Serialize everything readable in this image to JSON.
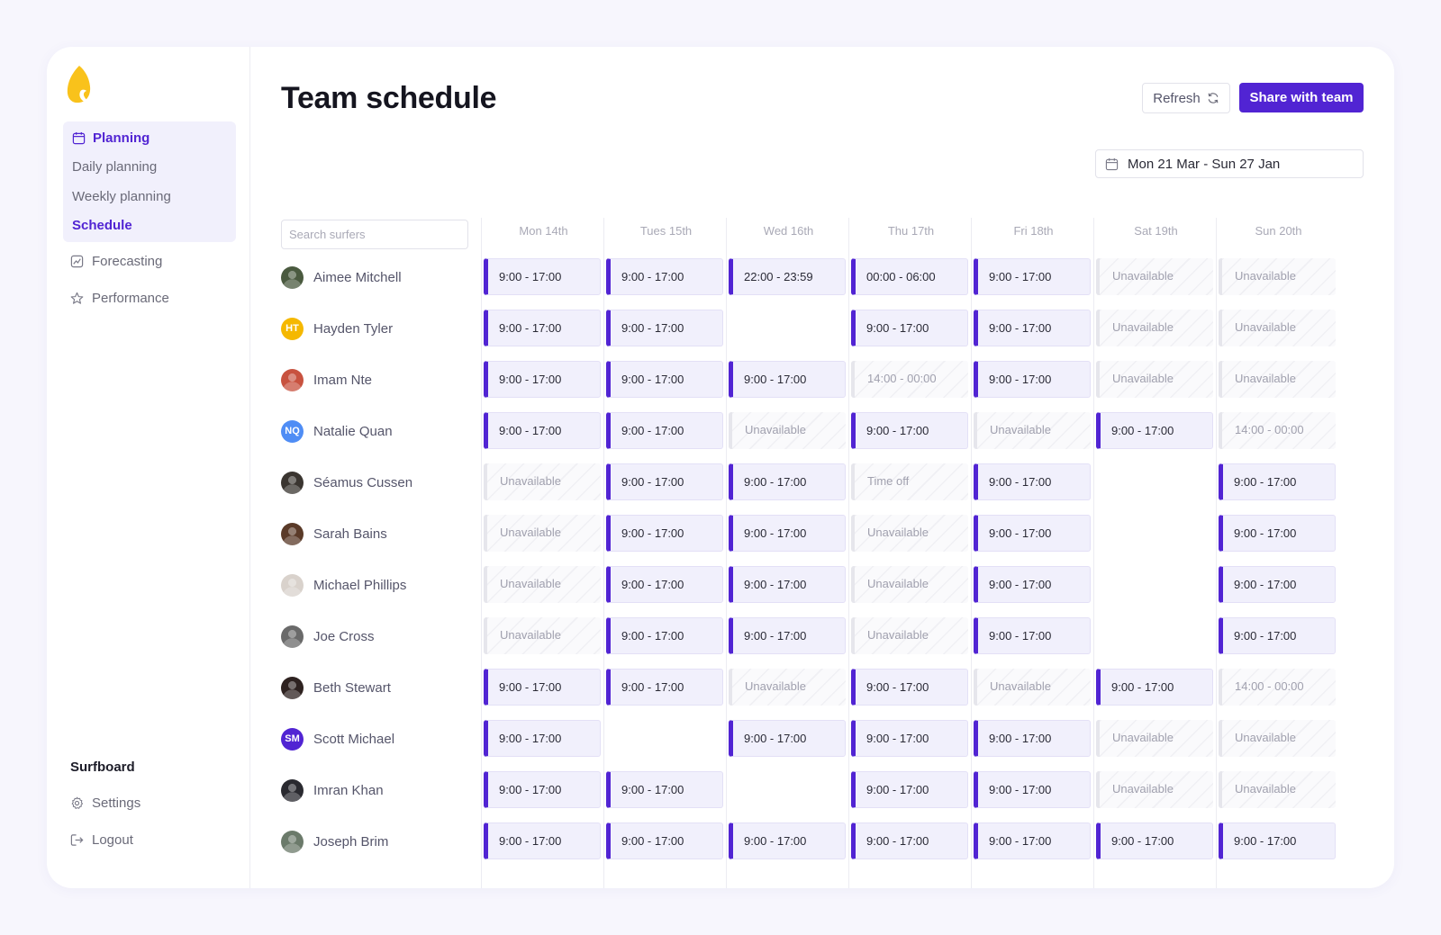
{
  "app": {
    "brand_name": "Surfboard",
    "accent_color": "#5124d3",
    "logo_color": "#f9c21b"
  },
  "sidebar": {
    "planning_label": "Planning",
    "planning_icon": "calendar-icon",
    "sub_items": [
      {
        "label": "Daily planning",
        "active": false
      },
      {
        "label": "Weekly planning",
        "active": false
      },
      {
        "label": "Schedule",
        "active": true
      }
    ],
    "items": [
      {
        "label": "Forecasting",
        "icon": "chart-icon"
      },
      {
        "label": "Performance",
        "icon": "star-icon"
      }
    ],
    "bottom_items": [
      {
        "label": "Settings",
        "icon": "gear-icon"
      },
      {
        "label": "Logout",
        "icon": "logout-icon"
      }
    ]
  },
  "header": {
    "title": "Team schedule",
    "refresh_label": "Refresh",
    "share_label": "Share with team",
    "date_range": "Mon 21 Mar - Sun 27 Jan"
  },
  "search": {
    "placeholder": "Search surfers"
  },
  "days": [
    "Mon 14th",
    "Tues 15th",
    "Wed 16th",
    "Thu 17th",
    "Fri 18th",
    "Sat 19th",
    "Sun 20th"
  ],
  "people": [
    {
      "name": "Aimee Mitchell",
      "avatar_initials": "",
      "avatar_color": "#4a5a3f",
      "shifts": [
        {
          "text": "9:00 - 17:00",
          "status": "on"
        },
        {
          "text": "9:00 - 17:00",
          "status": "on"
        },
        {
          "text": "22:00 - 23:59",
          "status": "on"
        },
        {
          "text": "00:00 - 06:00",
          "status": "on"
        },
        {
          "text": "9:00 - 17:00",
          "status": "on"
        },
        {
          "text": "Unavailable",
          "status": "off"
        },
        {
          "text": "Unavailable",
          "status": "off"
        }
      ]
    },
    {
      "name": "Hayden Tyler",
      "avatar_initials": "HT",
      "avatar_color": "#f5b800",
      "shifts": [
        {
          "text": "9:00 - 17:00",
          "status": "on"
        },
        {
          "text": "9:00 - 17:00",
          "status": "on"
        },
        {
          "text": "",
          "status": "empty"
        },
        {
          "text": "9:00 - 17:00",
          "status": "on"
        },
        {
          "text": "9:00 - 17:00",
          "status": "on"
        },
        {
          "text": "Unavailable",
          "status": "off"
        },
        {
          "text": "Unavailable",
          "status": "off"
        }
      ]
    },
    {
      "name": "Imam Nte",
      "avatar_initials": "",
      "avatar_color": "#c8523f",
      "shifts": [
        {
          "text": "9:00 - 17:00",
          "status": "on"
        },
        {
          "text": "9:00 - 17:00",
          "status": "on"
        },
        {
          "text": "9:00 - 17:00",
          "status": "on"
        },
        {
          "text": "14:00 - 00:00",
          "status": "off"
        },
        {
          "text": "9:00 - 17:00",
          "status": "on"
        },
        {
          "text": "Unavailable",
          "status": "off"
        },
        {
          "text": "Unavailable",
          "status": "off"
        }
      ]
    },
    {
      "name": "Natalie Quan",
      "avatar_initials": "NQ",
      "avatar_color": "#4f8df5",
      "shifts": [
        {
          "text": "9:00 - 17:00",
          "status": "on"
        },
        {
          "text": "9:00 - 17:00",
          "status": "on"
        },
        {
          "text": "Unavailable",
          "status": "off"
        },
        {
          "text": "9:00 - 17:00",
          "status": "on"
        },
        {
          "text": "Unavailable",
          "status": "off"
        },
        {
          "text": "9:00 - 17:00",
          "status": "on"
        },
        {
          "text": "14:00 - 00:00",
          "status": "off"
        }
      ]
    },
    {
      "name": "Séamus Cussen",
      "avatar_initials": "",
      "avatar_color": "#3a3530",
      "shifts": [
        {
          "text": "Unavailable",
          "status": "off"
        },
        {
          "text": "9:00 - 17:00",
          "status": "on"
        },
        {
          "text": "9:00 - 17:00",
          "status": "on"
        },
        {
          "text": "Time off",
          "status": "off"
        },
        {
          "text": "9:00 - 17:00",
          "status": "on"
        },
        {
          "text": "",
          "status": "empty"
        },
        {
          "text": "9:00 - 17:00",
          "status": "on"
        }
      ]
    },
    {
      "name": "Sarah Bains",
      "avatar_initials": "",
      "avatar_color": "#5a3a28",
      "shifts": [
        {
          "text": "Unavailable",
          "status": "off"
        },
        {
          "text": "9:00 - 17:00",
          "status": "on"
        },
        {
          "text": "9:00 - 17:00",
          "status": "on"
        },
        {
          "text": "Unavailable",
          "status": "off"
        },
        {
          "text": "9:00 - 17:00",
          "status": "on"
        },
        {
          "text": "",
          "status": "empty"
        },
        {
          "text": "9:00 - 17:00",
          "status": "on"
        }
      ]
    },
    {
      "name": "Michael Phillips",
      "avatar_initials": "",
      "avatar_color": "#d9d2cc",
      "shifts": [
        {
          "text": "Unavailable",
          "status": "off"
        },
        {
          "text": "9:00 - 17:00",
          "status": "on"
        },
        {
          "text": "9:00 - 17:00",
          "status": "on"
        },
        {
          "text": "Unavailable",
          "status": "off"
        },
        {
          "text": "9:00 - 17:00",
          "status": "on"
        },
        {
          "text": "",
          "status": "empty"
        },
        {
          "text": "9:00 - 17:00",
          "status": "on"
        }
      ]
    },
    {
      "name": "Joe Cross",
      "avatar_initials": "",
      "avatar_color": "#6a6a6a",
      "shifts": [
        {
          "text": "Unavailable",
          "status": "off"
        },
        {
          "text": "9:00 - 17:00",
          "status": "on"
        },
        {
          "text": "9:00 - 17:00",
          "status": "on"
        },
        {
          "text": "Unavailable",
          "status": "off"
        },
        {
          "text": "9:00 - 17:00",
          "status": "on"
        },
        {
          "text": "",
          "status": "empty"
        },
        {
          "text": "9:00 - 17:00",
          "status": "on"
        }
      ]
    },
    {
      "name": "Beth Stewart",
      "avatar_initials": "",
      "avatar_color": "#2e2220",
      "shifts": [
        {
          "text": "9:00 - 17:00",
          "status": "on"
        },
        {
          "text": "9:00 - 17:00",
          "status": "on"
        },
        {
          "text": "Unavailable",
          "status": "off"
        },
        {
          "text": "9:00 - 17:00",
          "status": "on"
        },
        {
          "text": "Unavailable",
          "status": "off"
        },
        {
          "text": "9:00 - 17:00",
          "status": "on"
        },
        {
          "text": "14:00 - 00:00",
          "status": "off"
        }
      ]
    },
    {
      "name": "Scott Michael",
      "avatar_initials": "SM",
      "avatar_color": "#5124d3",
      "shifts": [
        {
          "text": "9:00 - 17:00",
          "status": "on"
        },
        {
          "text": "",
          "status": "empty"
        },
        {
          "text": "9:00 - 17:00",
          "status": "on"
        },
        {
          "text": "9:00 - 17:00",
          "status": "on"
        },
        {
          "text": "9:00 - 17:00",
          "status": "on"
        },
        {
          "text": "Unavailable",
          "status": "off"
        },
        {
          "text": "Unavailable",
          "status": "off"
        }
      ]
    },
    {
      "name": "Imran Khan",
      "avatar_initials": "",
      "avatar_color": "#2a2a30",
      "shifts": [
        {
          "text": "9:00 - 17:00",
          "status": "on"
        },
        {
          "text": "9:00 - 17:00",
          "status": "on"
        },
        {
          "text": "",
          "status": "empty"
        },
        {
          "text": "9:00 - 17:00",
          "status": "on"
        },
        {
          "text": "9:00 - 17:00",
          "status": "on"
        },
        {
          "text": "Unavailable",
          "status": "off"
        },
        {
          "text": "Unavailable",
          "status": "off"
        }
      ]
    },
    {
      "name": "Joseph Brim",
      "avatar_initials": "",
      "avatar_color": "#6b7a6a",
      "shifts": [
        {
          "text": "9:00 - 17:00",
          "status": "on"
        },
        {
          "text": "9:00 - 17:00",
          "status": "on"
        },
        {
          "text": "9:00 - 17:00",
          "status": "on"
        },
        {
          "text": "9:00 - 17:00",
          "status": "on"
        },
        {
          "text": "9:00 - 17:00",
          "status": "on"
        },
        {
          "text": "9:00 - 17:00",
          "status": "on"
        },
        {
          "text": "9:00 - 17:00",
          "status": "on"
        }
      ]
    }
  ]
}
